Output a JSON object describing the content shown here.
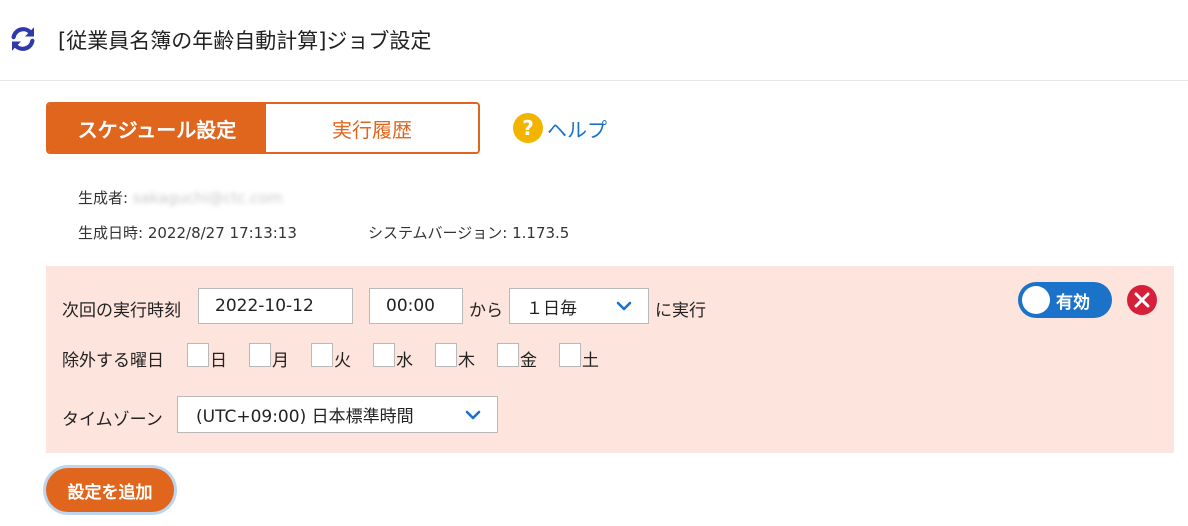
{
  "header": {
    "title": "[従業員名簿の年齢自動計算]ジョブ設定",
    "refresh_icon": "refresh-icon"
  },
  "tabs": [
    {
      "label": "スケジュール設定",
      "active": true
    },
    {
      "label": "実行履歴",
      "active": false
    }
  ],
  "help": {
    "label": "ヘルプ",
    "icon": "question-circle-icon"
  },
  "meta": {
    "creator_label": "生成者:",
    "creator_value": "sakaguchi@ctc.com",
    "created_at_label": "生成日時:",
    "created_at_value": "2022/8/27 17:13:13",
    "system_version_label": "システムバージョン:",
    "system_version_value": "1.173.5"
  },
  "schedule": {
    "next_run_label": "次回の実行時刻",
    "date_value": "2022-10-12",
    "time_value": "00:00",
    "from_label": "から",
    "interval_value": "１日毎",
    "suffix_label": "に実行",
    "enabled_label": "有効",
    "enabled": true,
    "exclude_label": "除外する曜日",
    "weekdays": [
      {
        "label": "日",
        "checked": false
      },
      {
        "label": "月",
        "checked": false
      },
      {
        "label": "火",
        "checked": false
      },
      {
        "label": "水",
        "checked": false
      },
      {
        "label": "木",
        "checked": false
      },
      {
        "label": "金",
        "checked": false
      },
      {
        "label": "土",
        "checked": false
      }
    ],
    "timezone_label": "タイムゾーン",
    "timezone_value": "(UTC+09:00) 日本標準時間"
  },
  "actions": {
    "add_label": "設定を追加"
  },
  "colors": {
    "accent": "#e0661e",
    "link": "#1a73c9",
    "panel_bg": "#fde4dd",
    "danger": "#d6203a",
    "help": "#f3b400"
  }
}
